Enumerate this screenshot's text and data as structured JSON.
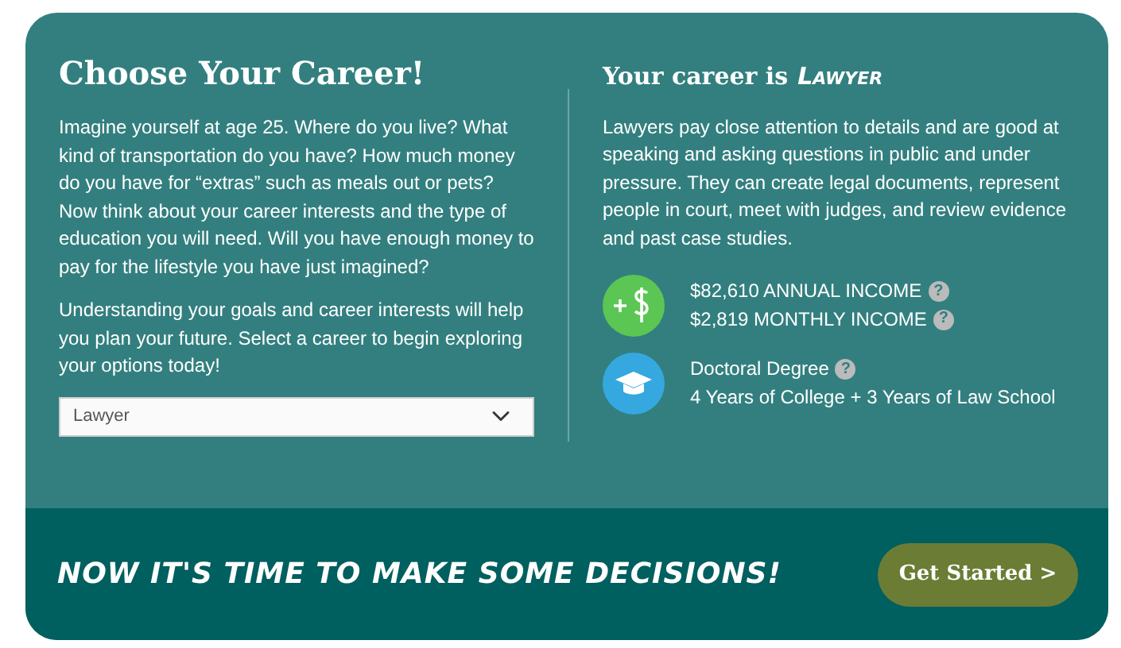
{
  "intro": {
    "title": "Choose Your Career!",
    "paragraphs": [
      "Imagine yourself at age 25. Where do you live? What kind of transportation do you have? How much money do you have for “extras” such as meals out or pets? Now think about your career interests and the type of education you will need. Will you have enough money to pay for the lifestyle you have just imagined?",
      "Understanding your goals and career interests will help you plan your future. Select a career to begin exploring your options today!"
    ],
    "career_select": {
      "value": "Lawyer"
    }
  },
  "result": {
    "title_prefix": "Your career is",
    "career": "Lawyer",
    "description": "Lawyers pay close attention to details and are good at speaking and asking questions in public and under pressure. They can create legal documents, represent people in court, meet with judges, and review evidence and past case studies.",
    "facts": [
      {
        "kind": "income",
        "color": "#5bc653",
        "lines": [
          {
            "text": "$82,610 ANNUAL INCOME",
            "help": "?"
          },
          {
            "text": "$2,819 MONTHLY INCOME",
            "help": "?"
          }
        ]
      },
      {
        "kind": "education",
        "color": "#35a8e0",
        "lines": [
          {
            "text": "Doctoral Degree",
            "help": "?"
          },
          {
            "text": "4 Years of College + 3 Years of Law School"
          }
        ]
      }
    ]
  },
  "footer": {
    "heading": "NOW IT'S TIME TO MAKE SOME DECISIONS!",
    "button": "Get Started >"
  }
}
